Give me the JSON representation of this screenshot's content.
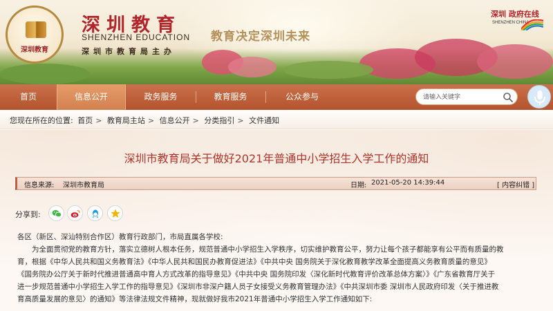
{
  "header": {
    "logo_text": "深圳教育",
    "site_title": "深圳教育",
    "site_title_en": "SHENZHEN EDUCATION",
    "site_subtitle": "深圳市教育局主办",
    "slogan": "教育决定深圳未来",
    "city_logo_cn": "深圳 政府在线",
    "city_logo_en": "SHENZHEN CHINA"
  },
  "nav": {
    "items": [
      {
        "label": "首页"
      },
      {
        "label": "信息公开",
        "active": true
      },
      {
        "label": "政务服务"
      },
      {
        "label": "教育服务"
      },
      {
        "label": "公众参与"
      }
    ],
    "search_placeholder": "请输入关键字",
    "search_icon": "search-icon",
    "mic_icon": "microphone-icon"
  },
  "breadcrumb": {
    "prefix": "您现在所在的位置:",
    "items": [
      "首页",
      "教育局主站",
      "信息公开",
      "分类指引",
      "文件通知"
    ],
    "separator": ">"
  },
  "article": {
    "title": "深圳市教育局关于做好2021年普通中小学招生入学工作的通知",
    "source_label": "信息来源:",
    "source": "深圳市教育局",
    "date_label": "日期:",
    "date": "2021-05-20 14:39:44",
    "correction_link": "[ 内容纠错 ]",
    "share_label": "分享到:",
    "share_icons": [
      "wechat-icon",
      "weibo-icon",
      "qq-icon",
      "qzone-icon"
    ],
    "body_lines": [
      "各区（新区、深汕特别合作区）教育行政部门，市局直属各学校:",
      "为全面贯彻党的教育方针，落实立德树人根本任务，规范普通中小学招生入学秩序，切实维护教育公平，努力让每个孩子都能享有公平而有质量的教",
      "育，根据《中华人民共和国义务教育法》《中华人民共和国民办教育促进法》《中共中央 国务院关于深化教育教学改革全面提高义务教育质量的意见》",
      "《国务院办公厅关于新时代推进普通高中育人方式改革的指导意见》《中共中央 国务院印发〈深化新时代教育评价改革总体方案〉》《广东省教育厅关于",
      "进一步规范普通中小学招生入学工作的指导意见》《深圳市非深户籍人员子女接受义务教育管理办法》《中共深圳市委 深圳市人民政府印发〈关于推进教",
      "育高质量发展的意见〉的通知》等法律法规文件精神，现就做好我市2021年普通中小学招生入学工作通知如下:"
    ]
  },
  "colors": {
    "nav_bg": "#b4532d",
    "nav_active": "#d3804f",
    "title_red": "#b0342a",
    "brand_red": "#b3232a"
  }
}
